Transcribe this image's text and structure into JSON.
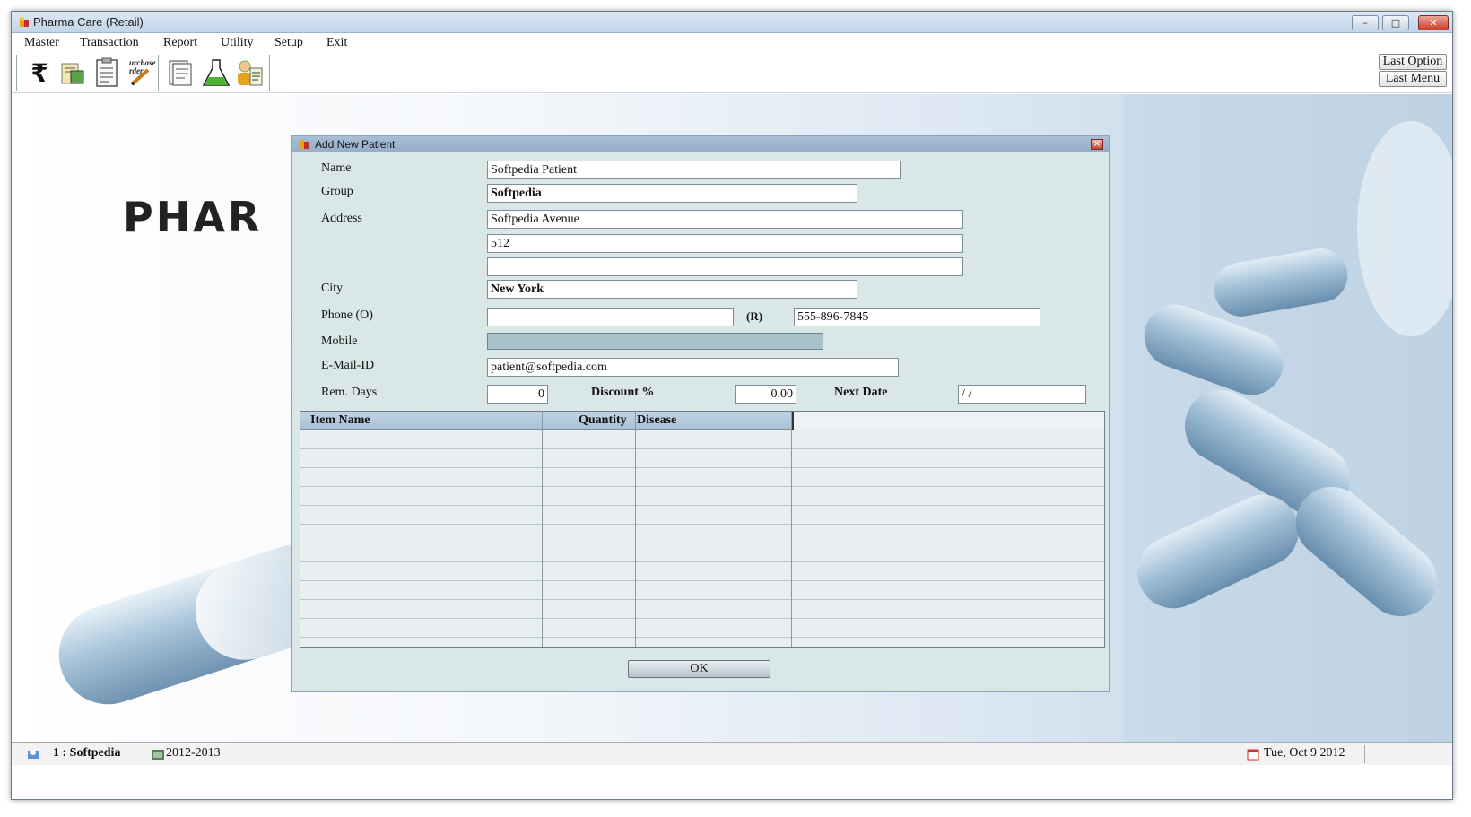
{
  "window": {
    "title": "Pharma Care (Retail)",
    "minimize": "–",
    "maximize": "□",
    "close": "✕"
  },
  "menu": [
    "Master",
    "Transaction",
    "Report",
    "Utility",
    "Setup",
    "Exit"
  ],
  "toolbar": {
    "icons": [
      "rupee-icon",
      "sales-icon",
      "clipboard-icon",
      "purchase-order-icon",
      "report-icon",
      "lab-flask-icon",
      "patient-icon"
    ],
    "rupee_symbol": "₹",
    "purchase_order_text": "urchase rder",
    "last_option": "Last Option",
    "last_menu": "Last Menu"
  },
  "background": {
    "logo_text": "PHAR"
  },
  "dialog": {
    "title": "Add New Patient",
    "close": "×",
    "labels": {
      "name": "Name",
      "group": "Group",
      "address": "Address",
      "city": "City",
      "phone_o": "Phone (O)",
      "phone_r": "(R)",
      "mobile": "Mobile",
      "email": "E-Mail-ID",
      "rem_days": "Rem. Days",
      "discount": "Discount %",
      "next_date": "Next Date"
    },
    "values": {
      "name": "Softpedia Patient",
      "group": "Softpedia",
      "address1": "Softpedia Avenue",
      "address2": "512",
      "address3": "",
      "city": "New York",
      "phone_o": "",
      "phone_r": "555-896-7845",
      "mobile": "",
      "email": "patient@softpedia.com",
      "rem_days": "0",
      "discount": "0.00",
      "next_date": " /  /"
    },
    "grid": {
      "columns": [
        "Item Name",
        "Quantity",
        "Disease"
      ],
      "row_count": 12
    },
    "ok": "OK"
  },
  "status": {
    "user": "1 : Softpedia",
    "year": "2012-2013",
    "date": "Tue, Oct 9 2012"
  },
  "colors": {
    "dialog_bg": "#d9e7e6",
    "grid_header": "#a9c1d6",
    "mobile_field": "#a9c1cb",
    "title_gradient": "#c3d5ea"
  }
}
